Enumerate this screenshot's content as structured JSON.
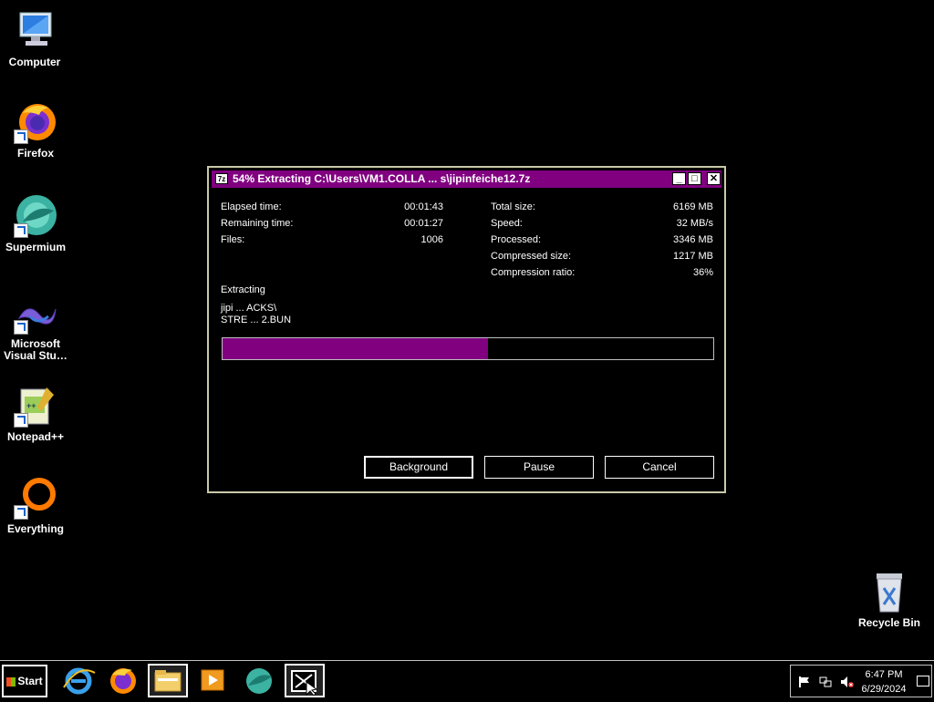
{
  "desktop": {
    "icons": [
      {
        "label": "Computer",
        "icon": "computer-icon"
      },
      {
        "label": "Firefox",
        "icon": "firefox-icon"
      },
      {
        "label": "Supermium",
        "icon": "supermium-icon"
      },
      {
        "label": "Microsoft Visual Stu…",
        "icon": "visual-studio-icon"
      },
      {
        "label": "Notepad++",
        "icon": "notepadpp-icon"
      },
      {
        "label": "Everything",
        "icon": "everything-icon"
      }
    ],
    "recycle_bin": "Recycle Bin"
  },
  "window": {
    "app_icon": "7z",
    "title": "54% Extracting C:\\Users\\VM1.COLLA ... s\\jipinfeiche12.7z",
    "stats_left": [
      {
        "label": "Elapsed time:",
        "value": "00:01:43"
      },
      {
        "label": "Remaining time:",
        "value": "00:01:27"
      },
      {
        "label": "Files:",
        "value": "1006"
      }
    ],
    "stats_right": [
      {
        "label": "Total size:",
        "value": "6169 MB"
      },
      {
        "label": "Speed:",
        "value": "32 MB/s"
      },
      {
        "label": "Processed:",
        "value": "3346 MB"
      },
      {
        "label": "Compressed size:",
        "value": "1217 MB"
      },
      {
        "label": "Compression ratio:",
        "value": "36%"
      }
    ],
    "status_label": "Extracting",
    "current_path_line1": "jipi ... ACKS\\",
    "current_path_line2": "STRE ... 2.BUN",
    "progress_fraction": 0.54,
    "buttons": {
      "background": "Background",
      "pause": "Pause",
      "cancel": "Cancel"
    }
  },
  "taskbar": {
    "start_label": "Start",
    "items": [
      "internet-explorer-icon",
      "firefox-icon",
      "file-explorer-icon",
      "media-player-icon",
      "supermium-icon",
      "7zip-icon"
    ],
    "time": "6:47 PM",
    "date": "6/29/2024"
  },
  "colors": {
    "accent": "#800080",
    "background": "#000000",
    "text": "#ffffff"
  }
}
